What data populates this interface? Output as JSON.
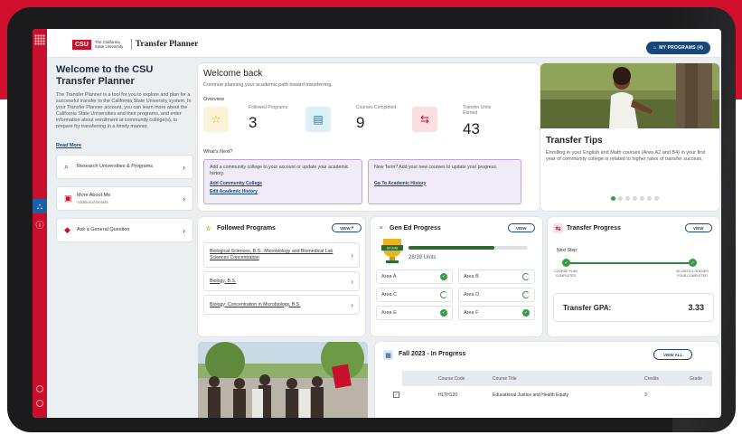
{
  "app": {
    "logo_csu": "CSU",
    "logo_university": "The California State University",
    "title": "Transfer Planner",
    "my_programs": "MY PROGRAMS (4)"
  },
  "intro": {
    "title": "Welcome to the CSU Transfer Planner",
    "text": "The Transfer Planner is a tool for you to explore and plan for a successful transfer to the California State University system. In your Transfer Planner account, you can learn more about the California State Universities and their programs, and enter information about enrollment at community college(s), to prepare for transferring in a timely manner.",
    "read_more": "Read More"
  },
  "actions": [
    {
      "label": "Research Universities & Programs",
      "sub": "",
      "icon": "search-icon"
    },
    {
      "label": "More About Me",
      "sub": "Additional Details",
      "icon": "clipboard-icon"
    },
    {
      "label": "Ask a General Question",
      "sub": "",
      "icon": "chat-icon"
    }
  ],
  "welcome": {
    "title": "Welcome back",
    "subtitle": "Continue planning your academic path toward transferring.",
    "overview": "Overview",
    "stats": [
      {
        "label": "Followed Programs",
        "value": "3",
        "icon": "star-icon",
        "color": "#fdf3d8"
      },
      {
        "label": "Courses Completed",
        "value": "9",
        "icon": "clipboard-icon",
        "color": "#dcf1f7"
      },
      {
        "label": "Transfer Units Earned",
        "value": "43",
        "icon": "transfer-icon",
        "color": "#fbe0e3"
      }
    ],
    "whats_next": "What's Next?",
    "next": [
      {
        "text": "Add a community college to your account or update your academic history.",
        "links": [
          "Add Community College",
          "Edit Academic History"
        ]
      },
      {
        "text": "New Term? Add your new courses to update your progress.",
        "links": [
          "Go To Academic History"
        ]
      }
    ]
  },
  "tips": {
    "title": "Transfer Tips",
    "text": "Enrolling in your English and Math courses (Area A2 and B4) in your first year of community college is related to higher rates of transfer success."
  },
  "followed": {
    "title": "Followed Programs",
    "view": "VIEW",
    "items": [
      "Biological Sciences, B.S.: Microbiology and Biomedical Lab Sciences Concentration",
      "Biology, B.S.",
      "Biology: Concentration in Microbiology, B.S."
    ]
  },
  "gened": {
    "title": "Gen Ed Progress",
    "view": "VIEW",
    "badge": "39 Units",
    "units": "28/39 Units",
    "progress": 0.72,
    "areas": [
      {
        "name": "Area A",
        "status": "done"
      },
      {
        "name": "Area B",
        "status": "progress"
      },
      {
        "name": "Area C",
        "status": "progress"
      },
      {
        "name": "Area D",
        "status": "progress"
      },
      {
        "name": "Area E",
        "status": "done"
      },
      {
        "name": "Area F",
        "status": "done"
      }
    ]
  },
  "transfer": {
    "title": "Transfer Progress",
    "view": "VIEW",
    "next_step": "Next Step:",
    "step1": "COURSE PLAN COMPLETED",
    "step2": "50 UNITS & GOLDEN FOUR COMPLETED",
    "gpa_label": "Transfer GPA:",
    "gpa_value": "3.33"
  },
  "term": {
    "title": "Fall 2023 - In Progress",
    "view_all": "VIEW ALL",
    "columns": [
      "Course Code",
      "Course Title",
      "Credits",
      "Grade"
    ],
    "rows": [
      {
        "code": "HLTH120",
        "title": "Educational Justice and Health Equity",
        "credits": "3",
        "grade": ""
      }
    ]
  },
  "colors": {
    "brand_red": "#c8102e",
    "brand_blue": "#16497b",
    "success_green": "#3a9a43"
  }
}
